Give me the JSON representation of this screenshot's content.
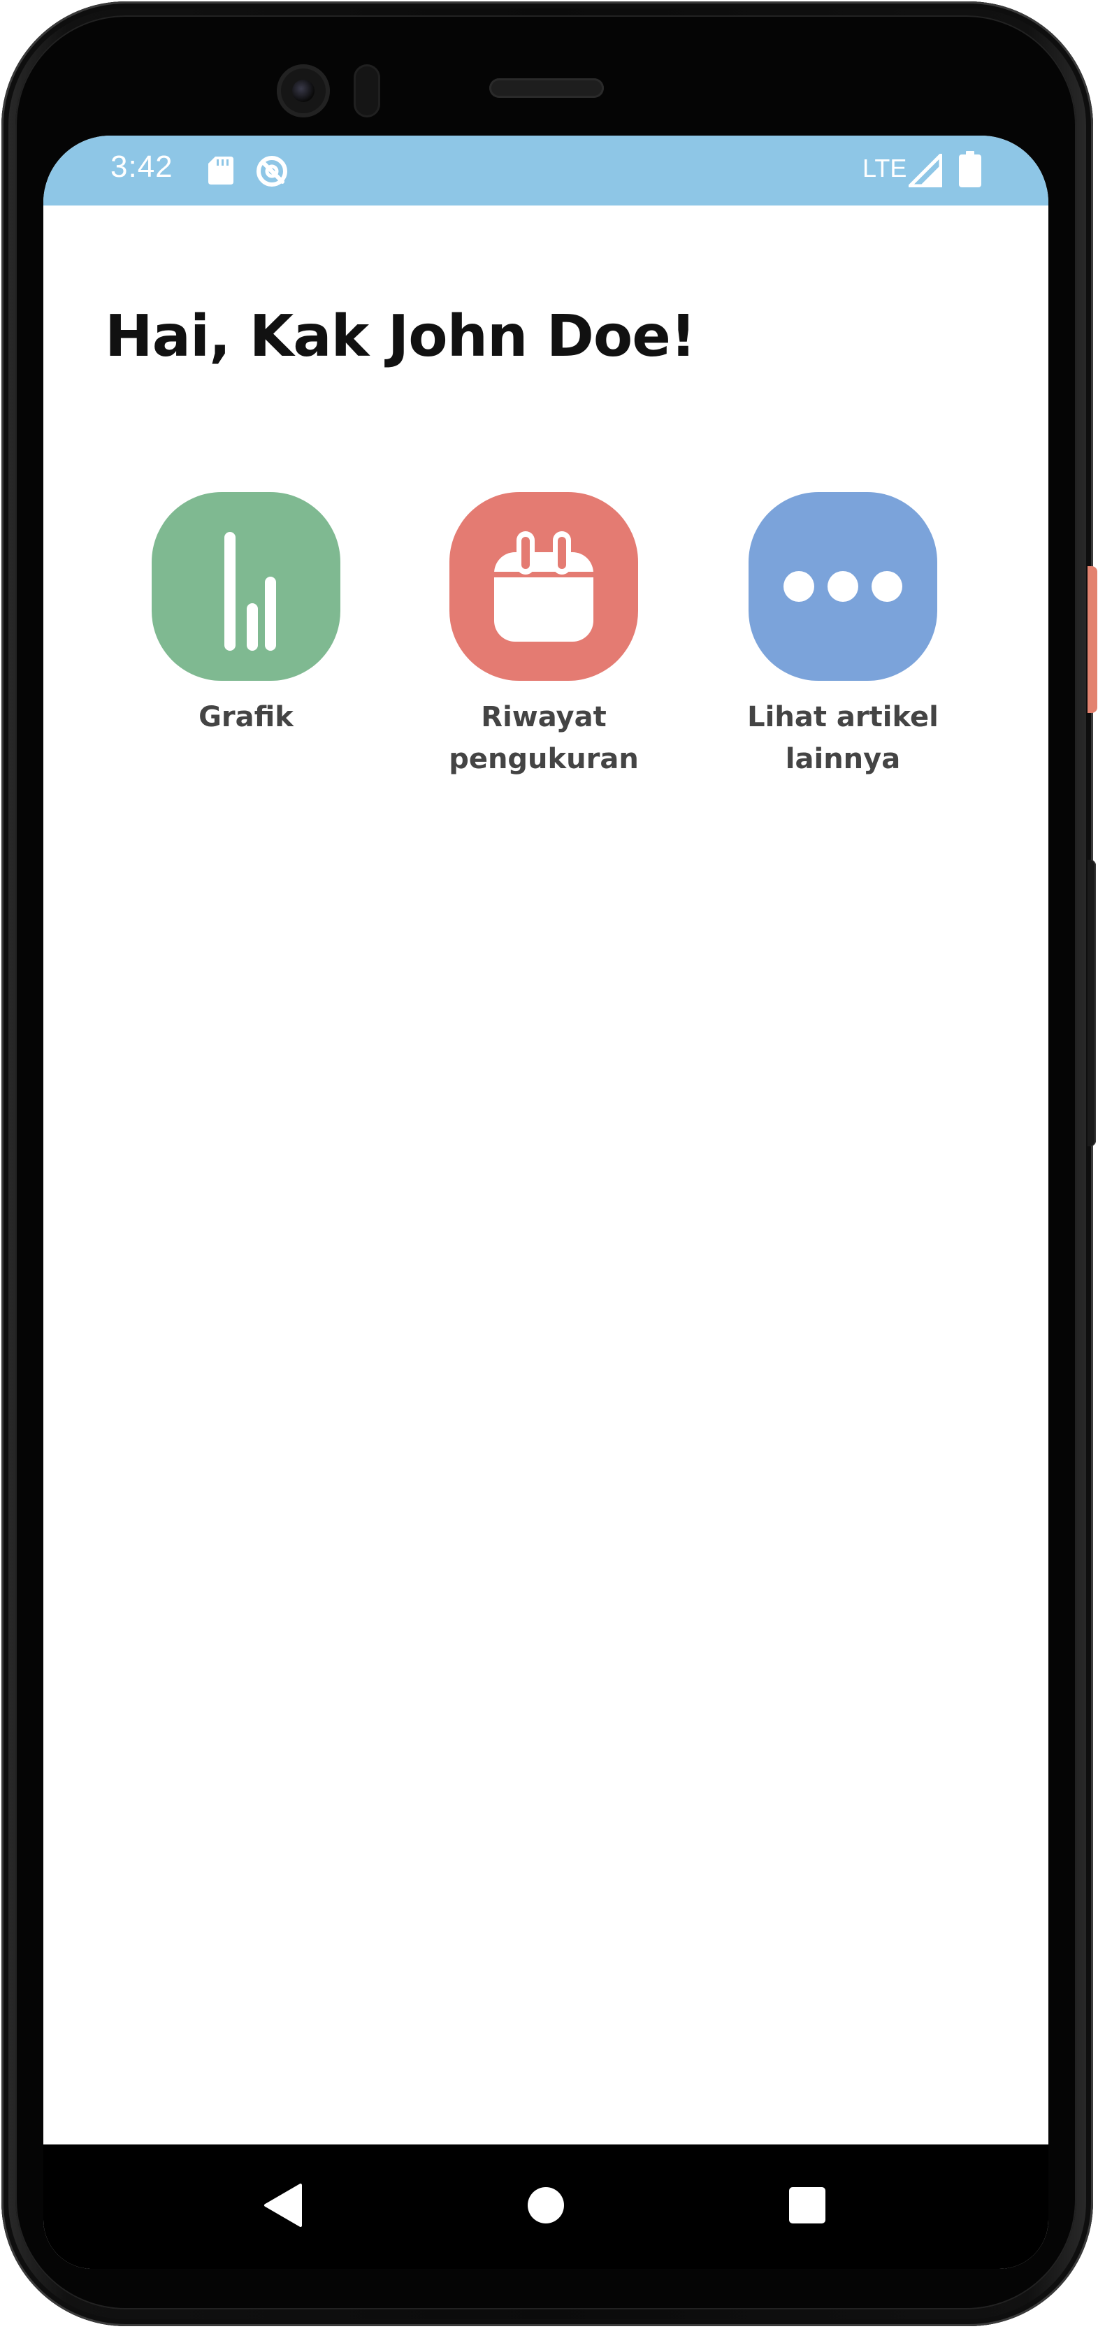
{
  "status_bar": {
    "time": "3:42",
    "network": "LTE",
    "background_color": "#8ec6e6",
    "icons": [
      "sd-card-icon",
      "sync-disabled-icon",
      "signal-icon",
      "battery-icon"
    ]
  },
  "home": {
    "greeting": "Hai, Kak John Doe!",
    "menu": [
      {
        "label": "Grafik",
        "icon": "bar-chart-icon",
        "color": "#7fb991"
      },
      {
        "label": "Riwayat\npengukuran",
        "icon": "calendar-icon",
        "color": "#e47b72"
      },
      {
        "label": "Lihat artikel\nlainnya",
        "icon": "more-dots-icon",
        "color": "#7ba3da"
      }
    ]
  },
  "nav_bar": {
    "icons": [
      "back-icon",
      "home-icon",
      "recents-icon"
    ]
  },
  "colors": {
    "side_button_accent": "#e3826f",
    "label_text": "#444444",
    "greeting_text": "#111111"
  }
}
